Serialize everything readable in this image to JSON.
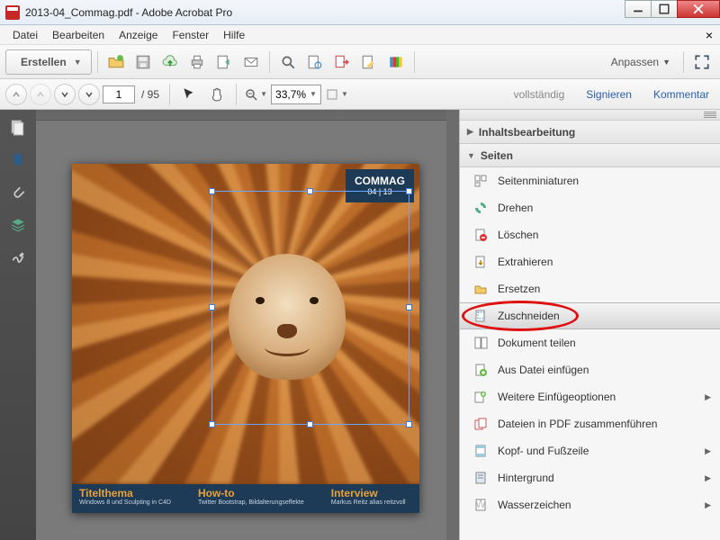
{
  "window": {
    "title": "2013-04_Commag.pdf - Adobe Acrobat Pro"
  },
  "menu": {
    "items": [
      "Datei",
      "Bearbeiten",
      "Anzeige",
      "Fenster",
      "Hilfe"
    ]
  },
  "toolbar": {
    "create": "Erstellen",
    "anpassen": "Anpassen"
  },
  "nav": {
    "page": "1",
    "page_total": "/  95",
    "zoom": "33,7%",
    "links": {
      "vollstaendig": "vollständig",
      "signieren": "Signieren",
      "kommentar": "Kommentar"
    }
  },
  "doc": {
    "badge_title": "COMMAG",
    "badge_sub": "04 | 13",
    "footer": [
      {
        "hd": "Titelthema",
        "tx": "Windows 8 und Sculpting in C4D"
      },
      {
        "hd": "How-to",
        "tx": "Twitter Bootstrap, Bildalterungseffekte"
      },
      {
        "hd": "Interview",
        "tx": "Markus Reitz alias reitzvoll"
      }
    ]
  },
  "right": {
    "sections": {
      "inhalt": "Inhaltsbearbeitung",
      "seiten": "Seiten"
    },
    "tools": [
      {
        "label": "Seitenminiaturen",
        "sub": false
      },
      {
        "label": "Drehen",
        "sub": false
      },
      {
        "label": "Löschen",
        "sub": false
      },
      {
        "label": "Extrahieren",
        "sub": false
      },
      {
        "label": "Ersetzen",
        "sub": false
      },
      {
        "label": "Zuschneiden",
        "sub": false
      },
      {
        "label": "Dokument teilen",
        "sub": false
      },
      {
        "label": "Aus Datei einfügen",
        "sub": false
      },
      {
        "label": "Weitere Einfügeoptionen",
        "sub": true
      },
      {
        "label": "Dateien in PDF zusammenführen",
        "sub": false
      },
      {
        "label": "Kopf- und Fußzeile",
        "sub": true
      },
      {
        "label": "Hintergrund",
        "sub": true
      },
      {
        "label": "Wasserzeichen",
        "sub": true
      }
    ]
  }
}
